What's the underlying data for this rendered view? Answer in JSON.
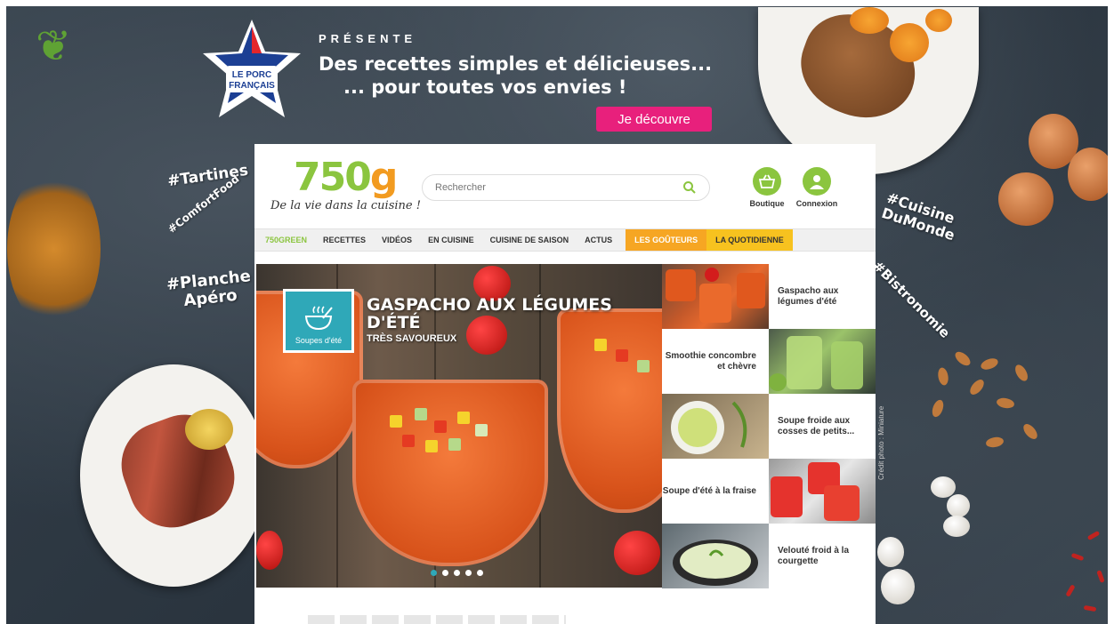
{
  "ad": {
    "brand_logo_text": "LE PORC FRANÇAIS",
    "presente": "PRÉSENTE",
    "tagline_line1": "Des recettes simples et délicieuses...",
    "tagline_line2": "... pour toutes vos envies !",
    "cta_label": "Je découvre",
    "hashtags": {
      "tartines": "#Tartines",
      "comfort": "#ComfortFood",
      "planche": "#Planche\nApéro",
      "cuisine": "#Cuisine\nDuMonde",
      "bistro": "#Bistronomie"
    },
    "credit": "Crédit photo : Miniature",
    "accent_color": "#e8207c"
  },
  "site": {
    "logo_number": "750",
    "logo_letter": "g",
    "logo_subtitle": "De la vie dans la cuisine !",
    "search_placeholder": "Rechercher",
    "shop_label": "Boutique",
    "login_label": "Connexion",
    "brand_green": "#8bc53f",
    "brand_orange": "#f29b20",
    "nav": [
      {
        "label": "750GREEN"
      },
      {
        "label": "RECETTES"
      },
      {
        "label": "VIDÉOS"
      },
      {
        "label": "EN CUISINE"
      },
      {
        "label": "CUISINE DE SAISON"
      },
      {
        "label": "ACTUS"
      },
      {
        "label": "LES GOÛTEURS"
      },
      {
        "label": "LA QUOTIDIENNE"
      }
    ],
    "hero": {
      "category": "Soupes d'été",
      "title": "GASPACHO AUX LÉGUMES D'ÉTÉ",
      "subtitle": "TRÈS SAVOUREUX",
      "dot_count": 5,
      "active_dot": 1
    },
    "related": [
      {
        "label": "Gaspacho aux légumes d'été"
      },
      {
        "label": "Smoothie concombre et chèvre"
      },
      {
        "label": "Soupe froide aux cosses de petits..."
      },
      {
        "label": "Soupe d'été à la fraise"
      },
      {
        "label": "Velouté froid à la courgette"
      }
    ]
  }
}
